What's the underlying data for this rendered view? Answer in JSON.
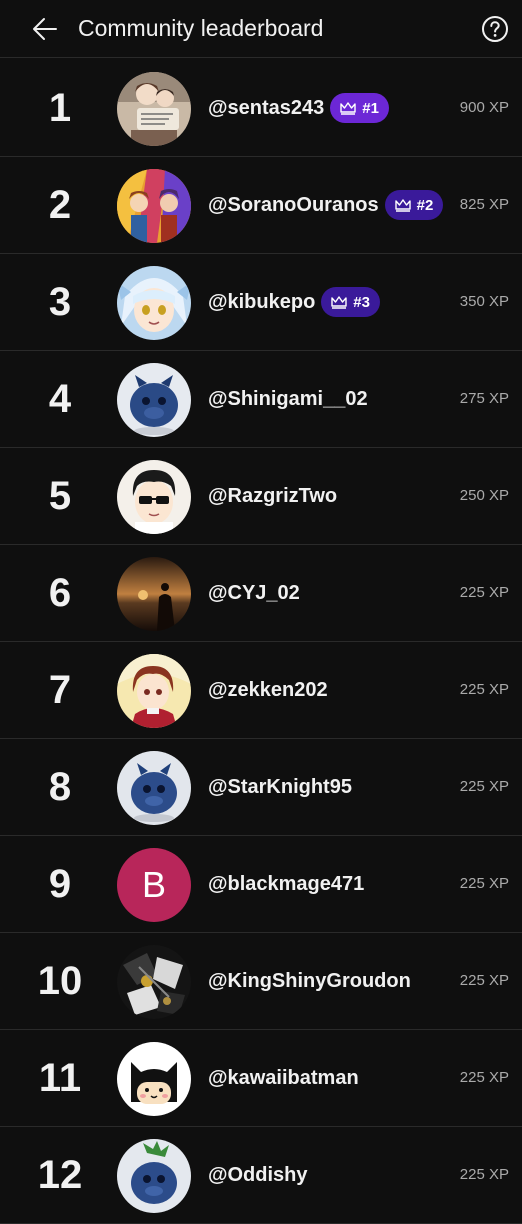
{
  "header": {
    "title": "Community leaderboard",
    "back_icon": "arrow-left-icon",
    "help_icon": "help-circle-icon"
  },
  "colors": {
    "background": "#0f0f0f",
    "badge_first": "#6c27d6",
    "badge_other": "#3a1a9a",
    "letter_avatar": "#b8265a",
    "xp_text": "#aaaaaa"
  },
  "leaderboard": [
    {
      "rank": "1",
      "username": "@sentas243",
      "badge": "#1",
      "xp": "900 XP"
    },
    {
      "rank": "2",
      "username": "@SoranoOuranos",
      "badge": "#2",
      "xp": "825 XP"
    },
    {
      "rank": "3",
      "username": "@kibukepo",
      "badge": "#3",
      "xp": "350 XP"
    },
    {
      "rank": "4",
      "username": "@Shinigami__02",
      "xp": "275 XP"
    },
    {
      "rank": "5",
      "username": "@RazgrizTwo",
      "xp": "250 XP"
    },
    {
      "rank": "6",
      "username": "@CYJ_02",
      "xp": "225 XP"
    },
    {
      "rank": "7",
      "username": "@zekken202",
      "xp": "225 XP"
    },
    {
      "rank": "8",
      "username": "@StarKnight95",
      "xp": "225 XP"
    },
    {
      "rank": "9",
      "username": "@blackmage471",
      "avatar_letter": "B",
      "xp": "225 XP"
    },
    {
      "rank": "10",
      "username": "@KingShinyGroudon",
      "xp": "225 XP"
    },
    {
      "rank": "11",
      "username": "@kawaiibatman",
      "xp": "225 XP"
    },
    {
      "rank": "12",
      "username": "@Oddishy",
      "xp": "225 XP"
    }
  ]
}
